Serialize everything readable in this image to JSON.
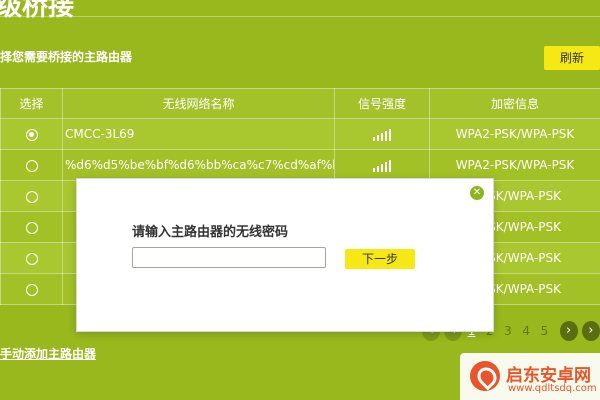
{
  "header": {
    "title": "级桥接",
    "section_label": "择您需要桥接的主路由器",
    "refresh_label": "刷新"
  },
  "table": {
    "columns": [
      "选择",
      "无线网络名称",
      "信号强度",
      "加密信息"
    ],
    "rows": [
      {
        "selected": true,
        "ssid": "CMCC-3L69",
        "signal_bars": 5,
        "encryption": "WPA2-PSK/WPA-PSK"
      },
      {
        "selected": false,
        "ssid": "%d6%d5%be%bf%d6%bb%ca%c7%cd%af%b...",
        "signal_bars": 5,
        "encryption": "WPA2-PSK/WPA-PSK"
      },
      {
        "selected": false,
        "ssid": "",
        "signal_bars": 0,
        "encryption": "2-PSK/WPA-PSK"
      },
      {
        "selected": false,
        "ssid": "",
        "signal_bars": 0,
        "encryption": "2-PSK/WPA-PSK"
      },
      {
        "selected": false,
        "ssid": "",
        "signal_bars": 0,
        "encryption": "2-PSK/WPA-PSK"
      },
      {
        "selected": false,
        "ssid": "",
        "signal_bars": 0,
        "encryption": "2-PSK/WPA-PSK"
      }
    ]
  },
  "pagination": {
    "pages": [
      "1",
      "2",
      "3",
      "4",
      "5"
    ],
    "current": "1",
    "prev_icon": "chevron-left-icon",
    "next_icon": "chevron-right-icon"
  },
  "manual_add_label": "手动添加主路由器",
  "dialog": {
    "title": "请输入主路由器的无线密码",
    "input_value": "",
    "input_placeholder": "",
    "next_label": "下一步",
    "close_icon": "close-icon"
  },
  "watermark": {
    "name": "启东安卓网",
    "url": "www.qdltsdq.com"
  },
  "colors": {
    "background": "#98b81e",
    "accent_button": "#f5e814",
    "close_button": "#8fb51d",
    "watermark": "#e9542a"
  }
}
